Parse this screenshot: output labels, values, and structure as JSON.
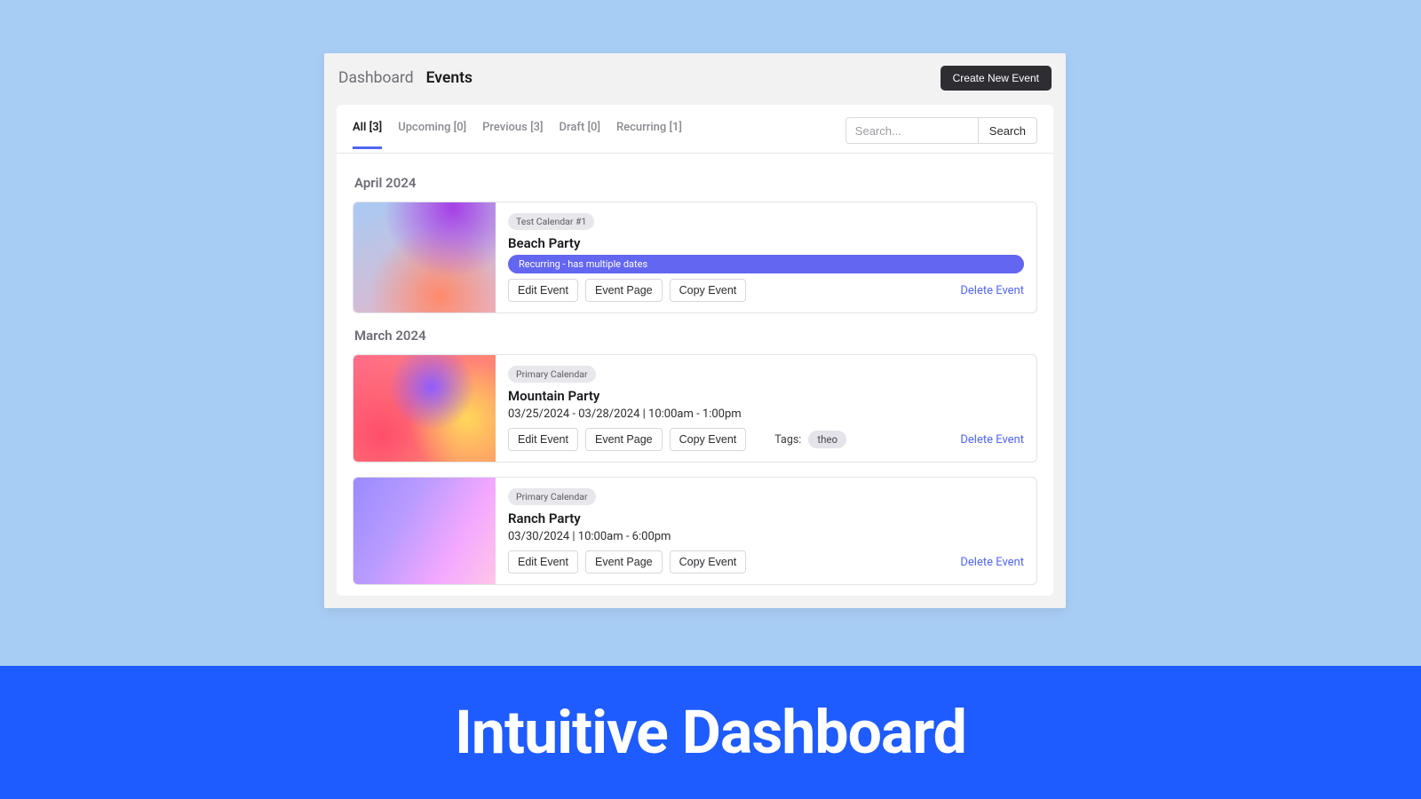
{
  "breadcrumbs": {
    "root": "Dashboard",
    "current": "Events"
  },
  "create_button": "Create New Event",
  "tabs": [
    {
      "label": "All [3]",
      "active": true
    },
    {
      "label": "Upcoming [0]",
      "active": false
    },
    {
      "label": "Previous [3]",
      "active": false
    },
    {
      "label": "Draft [0]",
      "active": false
    },
    {
      "label": "Recurring [1]",
      "active": false
    }
  ],
  "search": {
    "placeholder": "Search...",
    "button": "Search"
  },
  "months": [
    {
      "heading": "April 2024",
      "events": [
        {
          "calendar_chip": "Test Calendar #1",
          "title": "Beach Party",
          "recurring_badge": "Recurring - has multiple dates",
          "subtitle": "",
          "thumb": "g1",
          "actions": {
            "edit": "Edit Event",
            "page": "Event Page",
            "copy": "Copy Event"
          },
          "tags_label": "",
          "tags": [],
          "delete": "Delete Event"
        }
      ]
    },
    {
      "heading": "March 2024",
      "events": [
        {
          "calendar_chip": "Primary Calendar",
          "title": "Mountain Party",
          "recurring_badge": "",
          "subtitle": "03/25/2024 - 03/28/2024 | 10:00am - 1:00pm",
          "thumb": "g2",
          "actions": {
            "edit": "Edit Event",
            "page": "Event Page",
            "copy": "Copy Event"
          },
          "tags_label": "Tags:",
          "tags": [
            "theo"
          ],
          "delete": "Delete Event"
        },
        {
          "calendar_chip": "Primary Calendar",
          "title": "Ranch Party",
          "recurring_badge": "",
          "subtitle": "03/30/2024 | 10:00am - 6:00pm",
          "thumb": "g3",
          "actions": {
            "edit": "Edit Event",
            "page": "Event Page",
            "copy": "Copy Event"
          },
          "tags_label": "",
          "tags": [],
          "delete": "Delete Event"
        }
      ]
    }
  ],
  "banner": "Intuitive Dashboard"
}
